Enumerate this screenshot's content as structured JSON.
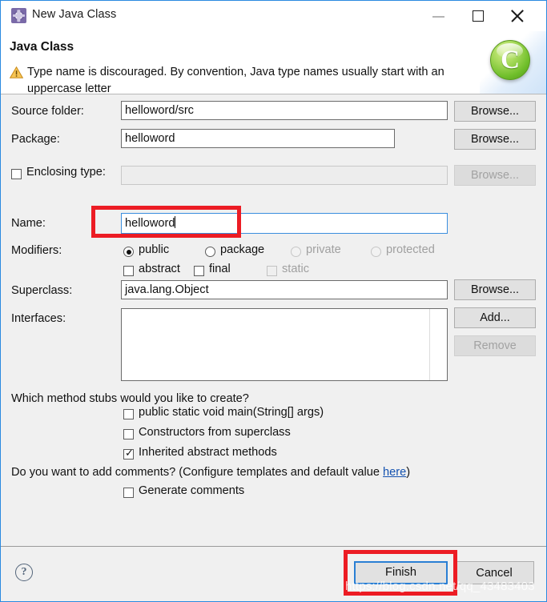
{
  "window": {
    "title": "New Java Class",
    "icon": "java-class-gear-icon",
    "controls": {
      "minimize": "—",
      "maximize": "□",
      "close": "✕"
    }
  },
  "header": {
    "title": "Java Class",
    "warning_icon": "warning-triangle-icon",
    "message": "Type name is discouraged. By convention, Java type names usually start with an uppercase letter",
    "logo_letter": "C"
  },
  "form": {
    "source_folder": {
      "label": "Source folder:",
      "value": "helloword/src",
      "button": "Browse..."
    },
    "package": {
      "label": "Package:",
      "value": "helloword",
      "button": "Browse..."
    },
    "enclosing_type": {
      "label": "Enclosing type:",
      "value": "",
      "checked": false,
      "button": "Browse...",
      "enabled": false
    },
    "name": {
      "label": "Name:",
      "value": "helloword"
    },
    "modifiers": {
      "label": "Modifiers:",
      "radios": [
        {
          "label": "public",
          "selected": true,
          "enabled": true
        },
        {
          "label": "package",
          "selected": false,
          "enabled": true
        },
        {
          "label": "private",
          "selected": false,
          "enabled": false
        },
        {
          "label": "protected",
          "selected": false,
          "enabled": false
        }
      ],
      "checkboxes": [
        {
          "label": "abstract",
          "checked": false,
          "enabled": true
        },
        {
          "label": "final",
          "checked": false,
          "enabled": true
        },
        {
          "label": "static",
          "checked": false,
          "enabled": false
        }
      ]
    },
    "superclass": {
      "label": "Superclass:",
      "value": "java.lang.Object",
      "button": "Browse..."
    },
    "interfaces": {
      "label": "Interfaces:",
      "items": [],
      "add_button": "Add...",
      "remove_button": "Remove",
      "remove_enabled": false
    },
    "method_stubs": {
      "question": "Which method stubs would you like to create?",
      "options": [
        {
          "label": "public static void main(String[] args)",
          "checked": false
        },
        {
          "label": "Constructors from superclass",
          "checked": false
        },
        {
          "label": "Inherited abstract methods",
          "checked": true
        }
      ]
    },
    "comments": {
      "question_prefix": "Do you want to add comments? (Configure templates and default value ",
      "link": "here",
      "question_suffix": ")",
      "option": {
        "label": "Generate comments",
        "checked": false
      }
    }
  },
  "footer": {
    "help_icon": "help-question-icon",
    "finish_label": "Finish",
    "cancel_label": "Cancel"
  },
  "watermark": "https://blog.csdn.net/qq_43483403",
  "colors": {
    "window_border": "#2a8ae0",
    "body_background": "#f0f0f0",
    "annotation_red": "#ec1c24",
    "focus_blue": "#2a7fd4",
    "link_blue": "#1452b0",
    "logo_green": "#6fbe2a",
    "warning_orange": "#f0a830"
  }
}
